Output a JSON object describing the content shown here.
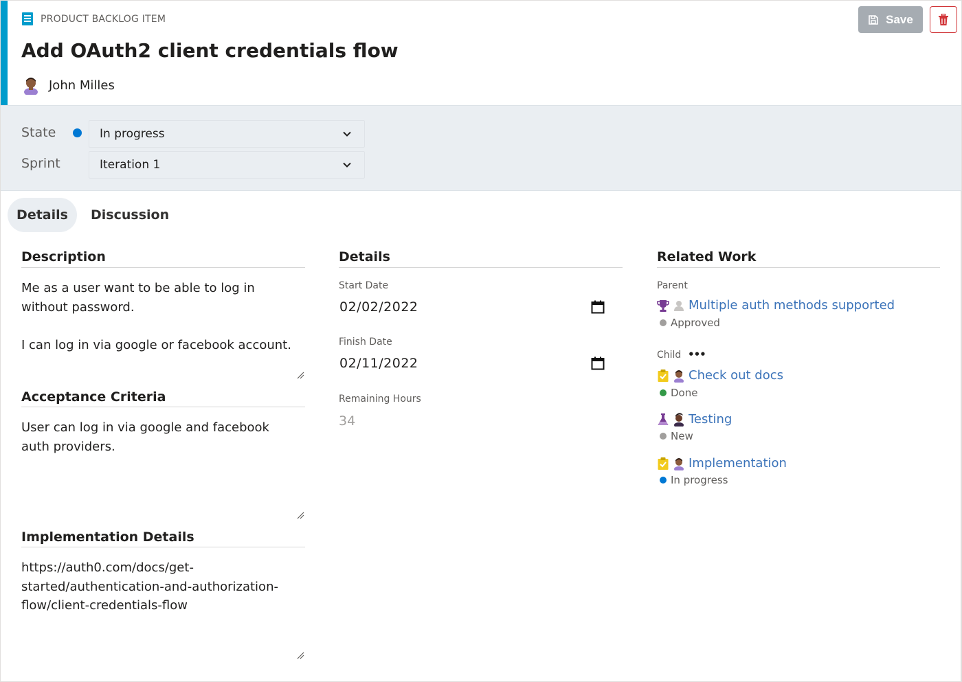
{
  "header": {
    "item_type": "PRODUCT BACKLOG ITEM",
    "title": "Add OAuth2 client credentials flow",
    "assignee": "John Milles",
    "save_label": "Save",
    "accent_color": "#009ccc"
  },
  "fields": {
    "state_label": "State",
    "state_value": "In progress",
    "state_color": "#0078d4",
    "sprint_label": "Sprint",
    "sprint_value": "Iteration 1"
  },
  "tabs": [
    {
      "label": "Details",
      "active": true
    },
    {
      "label": "Discussion",
      "active": false
    }
  ],
  "description": {
    "title": "Description",
    "lines": [
      "Me as a user want to be able to log in",
      "without password.",
      "",
      "I can log in via google or facebook account."
    ]
  },
  "acceptance": {
    "title": "Acceptance Criteria",
    "lines": [
      "User can log in via google and facebook",
      "auth providers."
    ]
  },
  "implementation": {
    "title": "Implementation Details",
    "lines": [
      "https://auth0.com/docs/get-",
      "started/authentication-and-authorization-",
      "flow/client-credentials-flow"
    ]
  },
  "details": {
    "title": "Details",
    "start_label": "Start Date",
    "start_value": "02/02/2022",
    "finish_label": "Finish Date",
    "finish_value": "02/11/2022",
    "remaining_label": "Remaining Hours",
    "remaining_value": "34"
  },
  "related": {
    "title": "Related Work",
    "parent_label": "Parent",
    "parent": {
      "title": "Multiple auth methods supported",
      "status": "Approved",
      "status_color": "#a19f9d",
      "icon": "trophy-icon"
    },
    "child_label": "Child",
    "children": [
      {
        "title": "Check out docs",
        "status": "Done",
        "status_color": "#339947",
        "icon": "task-icon"
      },
      {
        "title": "Testing",
        "status": "New",
        "status_color": "#a19f9d",
        "icon": "test-flask-icon"
      },
      {
        "title": "Implementation",
        "status": "In progress",
        "status_color": "#0078d4",
        "icon": "task-icon"
      }
    ]
  }
}
